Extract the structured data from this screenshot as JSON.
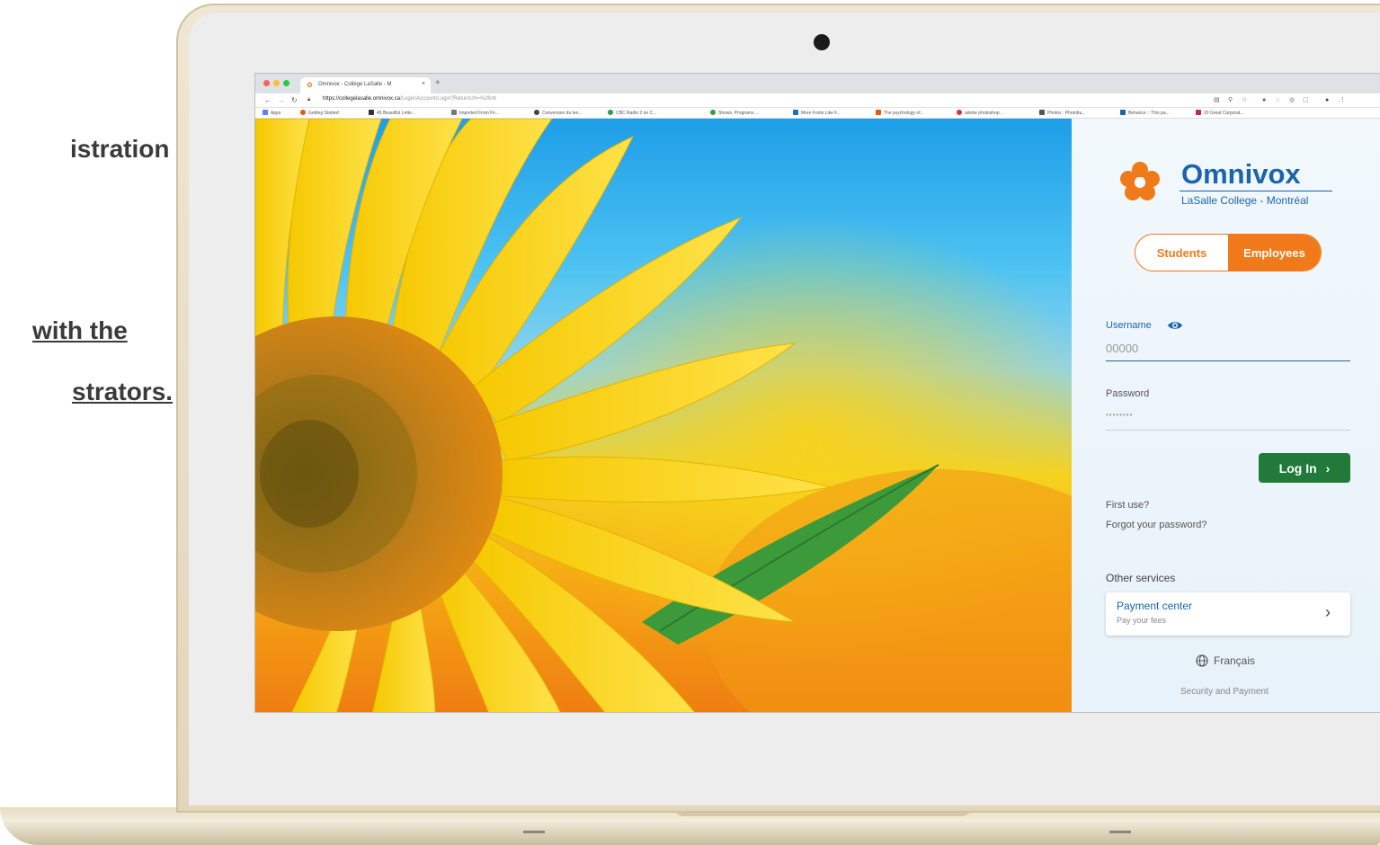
{
  "slide": {
    "line1": "istration",
    "line2": " with the",
    "line3": "strators."
  },
  "browser": {
    "tab_title": "Omnivox - Collège LaSalle - M",
    "tab_close": "×",
    "new_tab": "+",
    "url_host": "https://collegelasalle.omnivox.ca",
    "url_path": "/Login/Account/Login?ReturnUrl=%2fintr",
    "bookmarks": [
      "Apps",
      "Getting Started",
      "45 Beautiful Lette...",
      "Imported From Fir...",
      "Conversion du tex...",
      "CBC Radio 2 on C...",
      "Shows, Programs ...",
      "More Fonts Like F...",
      "The psychology of...",
      "adobe photoshop ...",
      "Photos : Photobu...",
      "Behance :: This pa...",
      "20 Great Corporat..."
    ]
  },
  "login": {
    "brand": "Omnivox",
    "subtitle": "LaSalle College - Montréal",
    "tab_students": "Students",
    "tab_employees": "Employees",
    "username_label": "Username",
    "username_placeholder": "00000",
    "password_label": "Password",
    "password_placeholder": "••••••••",
    "login_button": "Log In",
    "first_use": "First use?",
    "forgot": "Forgot your password?",
    "other_services": "Other services",
    "payment_title": "Payment center",
    "payment_sub": "Pay your fees",
    "language": "Français",
    "security": "Security and Payment"
  },
  "colors": {
    "accent_orange": "#f07a1a",
    "brand_blue": "#1b64ad",
    "login_green": "#217a3a"
  },
  "icons": {
    "eye": "eye-icon",
    "globe": "globe-icon",
    "chevron": "chevron-right-icon",
    "flower": "omnivox-flower-logo"
  }
}
